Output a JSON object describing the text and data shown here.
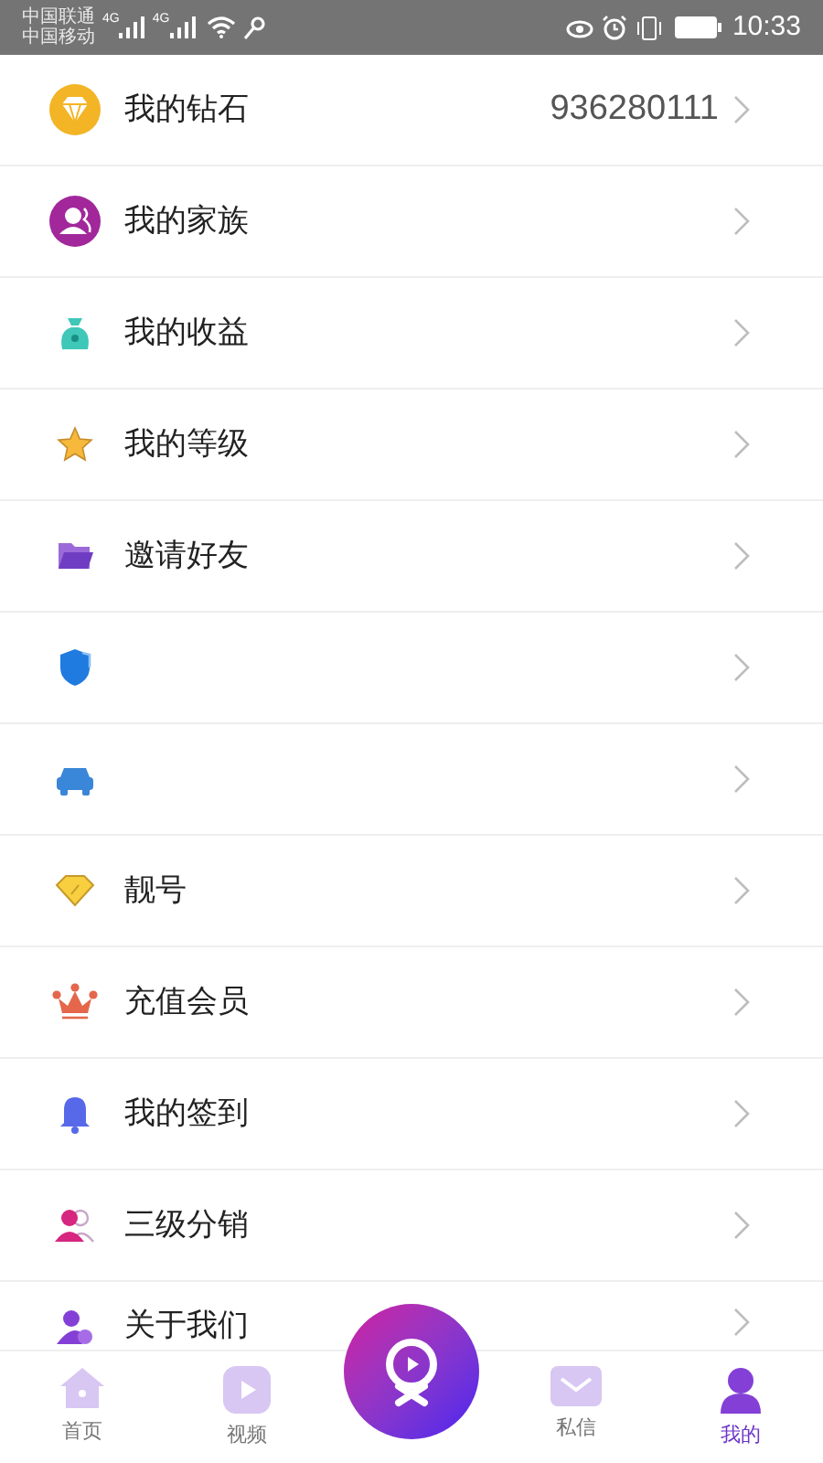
{
  "status_bar": {
    "carriers": [
      "中国联通",
      "中国移动"
    ],
    "network_labels": [
      "4G",
      "4G"
    ],
    "time": "10:33"
  },
  "menu": [
    {
      "kind": "labeled",
      "label": "我的钻石",
      "value": "936280111"
    },
    {
      "kind": "labeled",
      "label": "我的家族"
    },
    {
      "kind": "labeled",
      "label": "我的收益"
    },
    {
      "kind": "labeled",
      "label": "我的等级"
    },
    {
      "kind": "labeled",
      "label": "邀请好友"
    },
    {
      "kind": "icon_only"
    },
    {
      "kind": "icon_only"
    },
    {
      "kind": "labeled",
      "label": "靓号"
    },
    {
      "kind": "labeled",
      "label": "充值会员"
    },
    {
      "kind": "labeled",
      "label": "我的签到"
    },
    {
      "kind": "labeled",
      "label": "三级分销"
    },
    {
      "kind": "labeled",
      "label": "关于我们"
    }
  ],
  "bottom_nav": [
    {
      "label": "首页",
      "selected": false
    },
    {
      "label": "视频",
      "selected": false
    },
    {
      "label": "私信",
      "selected": false
    },
    {
      "label": "我的",
      "selected": true
    }
  ]
}
